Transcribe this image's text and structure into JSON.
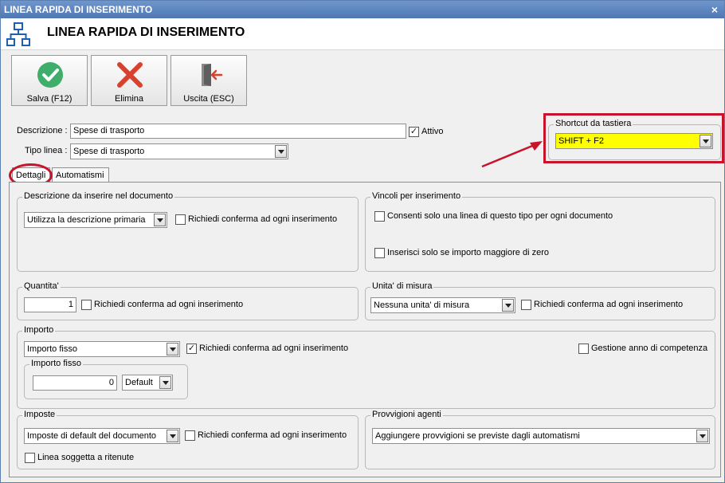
{
  "window": {
    "title": "LINEA RAPIDA DI INSERIMENTO",
    "close_glyph": "×"
  },
  "header": {
    "title": "LINEA RAPIDA DI INSERIMENTO",
    "icon": "network-icon"
  },
  "toolbar": {
    "save_label": "Salva (F12)",
    "delete_label": "Elimina",
    "exit_label": "Uscita (ESC)"
  },
  "form": {
    "descrizione_label": "Descrizione :",
    "descrizione_value": "Spese di trasporto",
    "attivo_label": "Attivo",
    "attivo_checked": true,
    "tipo_linea_label": "Tipo linea :",
    "tipo_linea_value": "Spese di trasporto"
  },
  "shortcut": {
    "group_title": "Shortcut da tastiera",
    "value": "SHIFT + F2",
    "highlight_color": "#ffff00"
  },
  "tabs": [
    {
      "label": "Dettagli",
      "active": true
    },
    {
      "label": "Automatismi",
      "active": false
    }
  ],
  "descrizione_doc": {
    "title": "Descrizione da inserire nel documento",
    "combo_value": "Utilizza la descrizione primaria",
    "confirm_label": "Richiedi conferma ad ogni inserimento"
  },
  "vincoli": {
    "title": "Vincoli per inserimento",
    "option1": "Consenti solo una linea di questo tipo per ogni documento",
    "option2": "Inserisci solo se importo maggiore di zero"
  },
  "quantita": {
    "title": "Quantita'",
    "value": "1",
    "confirm_label": "Richiedi conferma ad ogni inserimento"
  },
  "unita": {
    "title": "Unita' di misura",
    "combo_value": "Nessuna unita' di misura",
    "confirm_label": "Richiedi conferma ad ogni inserimento"
  },
  "importo": {
    "title": "Importo",
    "combo_value": "Importo fisso",
    "confirm_label": "Richiedi conferma ad ogni inserimento",
    "confirm_checked": true,
    "gestione_label": "Gestione anno di competenza",
    "fisso_title": "Importo fisso",
    "fisso_value": "0",
    "fisso_combo": "Default"
  },
  "imposte": {
    "title": "Imposte",
    "combo_value": "Imposte di default del documento",
    "confirm_label": "Richiedi conferma ad ogni inserimento",
    "ritenute_label": "Linea soggetta a ritenute"
  },
  "provvigioni": {
    "title": "Provvigioni agenti",
    "combo_value": "Aggiungere provvigioni se previste dagli automatismi"
  },
  "colors": {
    "annotation_red": "#c8142b",
    "save_green": "#3fae6a",
    "delete_red": "#d9412f"
  }
}
